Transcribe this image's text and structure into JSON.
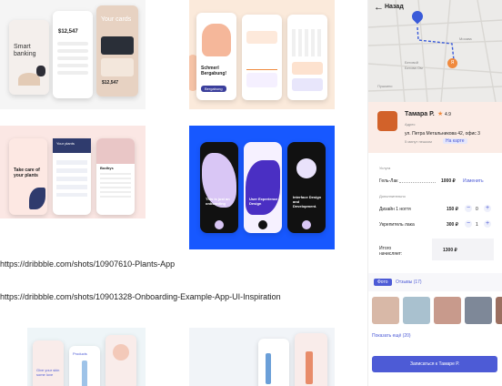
{
  "links": {
    "plants": "https://dribbble.com/shots/10907610-Plants-App",
    "onboarding": "https://dribbble.com/shots/10901328-Onboarding-Example-App-UI-Inspiration"
  },
  "card1": {
    "title": "Smart banking",
    "balance": "$12,547",
    "cards_title": "Your cards",
    "cards_balance": "$12,547"
  },
  "card2": {
    "heading": "Schmerl Bergabung!",
    "button": "Bergabung"
  },
  "card3": {
    "heading": "Take care of your plants",
    "tab1": "Your plants",
    "tab2": "Bodhys"
  },
  "card4": {
    "screen1": "This is just an onboarding",
    "screen2": "User Experience Design",
    "screen3": "Interface Design and Development."
  },
  "card5": {
    "heading": "Give your skin some love"
  },
  "card6": {
    "heading": "Products"
  },
  "panel": {
    "back_label": "Назад",
    "map_labels": [
      "Беговой",
      "Бегова Ом",
      "Москва",
      "Пушкино"
    ],
    "pin_letter": "Я",
    "master_name": "Тамара Р.",
    "rating": "4.9",
    "address_label": "Адрес",
    "address": "ул. Петра Метальникова 42, офис 3",
    "walk_time": "5 минут пешком",
    "map_link": "На карте",
    "service_section": "Услуга",
    "service_name": "Гель-Лак",
    "service_price": "1000 ₽",
    "change_link": "Изменить",
    "extras_section": "Дополнительно",
    "extras": [
      {
        "name": "Дизайн 1 ногтя",
        "price": "150 ₽",
        "qty": "0"
      },
      {
        "name": "Укрепитель лака",
        "price": "300 ₽",
        "qty": "1"
      }
    ],
    "total_label": "Итого\nначисляет:",
    "total_value": "1300 ₽",
    "tab_photo": "Фото",
    "tab_reviews": "Отзывы (17)",
    "show_more": "Показать ещё (20)",
    "book_button": "Записаться к Тамаре Р.",
    "colors": {
      "accent": "#4d5bd6",
      "map": "#ecebe9",
      "pin": "#3a5bd9",
      "orange": "#f08a3e"
    }
  }
}
